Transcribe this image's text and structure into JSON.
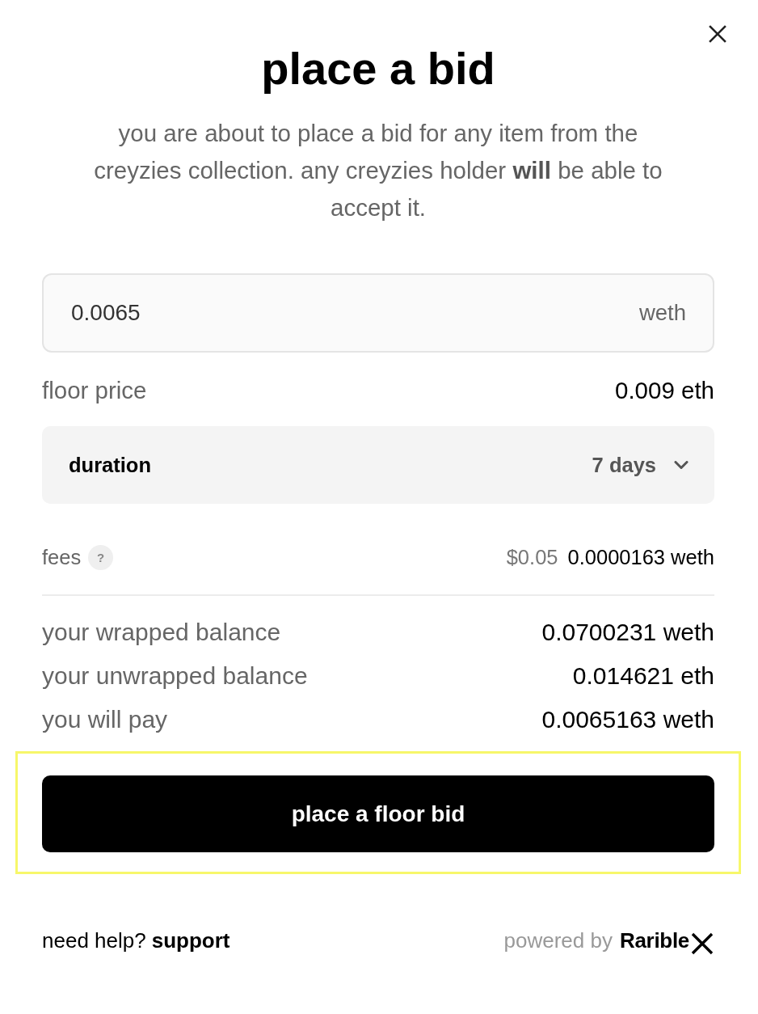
{
  "dialog": {
    "title": "place a bid",
    "description": "you are about to place a bid for any item from the creyzies collection. any creyzies holder **will** be able to accept it."
  },
  "bid_field": {
    "value": "0.0065",
    "unit": "weth"
  },
  "floor_price": {
    "label": "floor price",
    "value": "0.009 eth"
  },
  "duration": {
    "label": "duration",
    "value": "7 days",
    "expanded": false
  },
  "fees": {
    "label": "fees",
    "help": "?",
    "usd": "$0.05",
    "value": "0.0000163 weth"
  },
  "summary": [
    {
      "label": "your wrapped balance",
      "value": "0.0700231 weth"
    },
    {
      "label": "your unwrapped balance",
      "value": "0.014621 eth"
    },
    {
      "label": "you will pay",
      "value": "0.0065163 weth"
    }
  ],
  "submit_button": {
    "label": "place a floor bid",
    "highlighted": true
  },
  "footer": {
    "help_prompt": "need help?",
    "help_link": "support",
    "powered_by": "powered by",
    "brand": "Rarible"
  }
}
